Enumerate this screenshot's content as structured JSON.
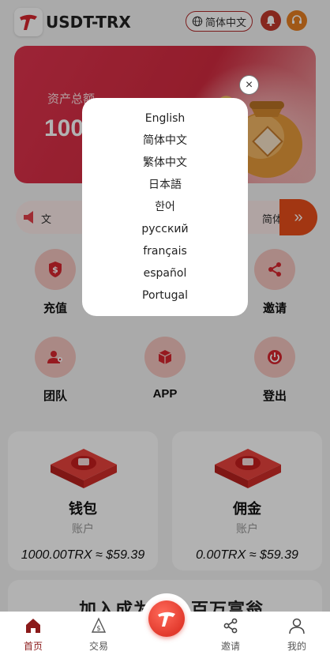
{
  "header": {
    "app_title": "USDT-TRX",
    "language_button": "简体中文",
    "icons": [
      "logo-icon",
      "globe-icon",
      "bell-icon",
      "headset-icon"
    ]
  },
  "asset_card": {
    "label": "资产总额",
    "value": "100"
  },
  "notice": {
    "left_text": "文",
    "right_text": "简体中文",
    "arrow": "»"
  },
  "grid": [
    {
      "label": "充值",
      "icon": "dollar-shield-icon"
    },
    {
      "label": "邀请",
      "icon": "share-icon"
    },
    {
      "label": "团队",
      "icon": "team-icon"
    },
    {
      "label": "APP",
      "icon": "cube-icon"
    },
    {
      "label": "登出",
      "icon": "power-icon"
    }
  ],
  "wallets": [
    {
      "title": "钱包",
      "subtitle": "账户",
      "amount": "1000.00TRX ≈ $59.39"
    },
    {
      "title": "佣金",
      "subtitle": "账户",
      "amount": "0.00TRX ≈ $59.39"
    }
  ],
  "promo": {
    "text_left": "加入成为",
    "text_right": "百万富翁"
  },
  "bottom_nav": [
    {
      "label": "首页",
      "icon": "home-icon",
      "active": true
    },
    {
      "label": "交易",
      "icon": "trade-icon"
    },
    {
      "label": "邀请",
      "icon": "share-icon"
    },
    {
      "label": "我的",
      "icon": "user-icon"
    }
  ],
  "language_modal": {
    "options": [
      "English",
      "简体中文",
      "繁体中文",
      "日本語",
      "한어",
      "русский",
      "français",
      "español",
      "Portugal"
    ],
    "close": "×"
  },
  "colors": {
    "brand_red": "#d22a3f",
    "accent_orange": "#e84e1b",
    "active_nav": "#8b1a1a"
  }
}
